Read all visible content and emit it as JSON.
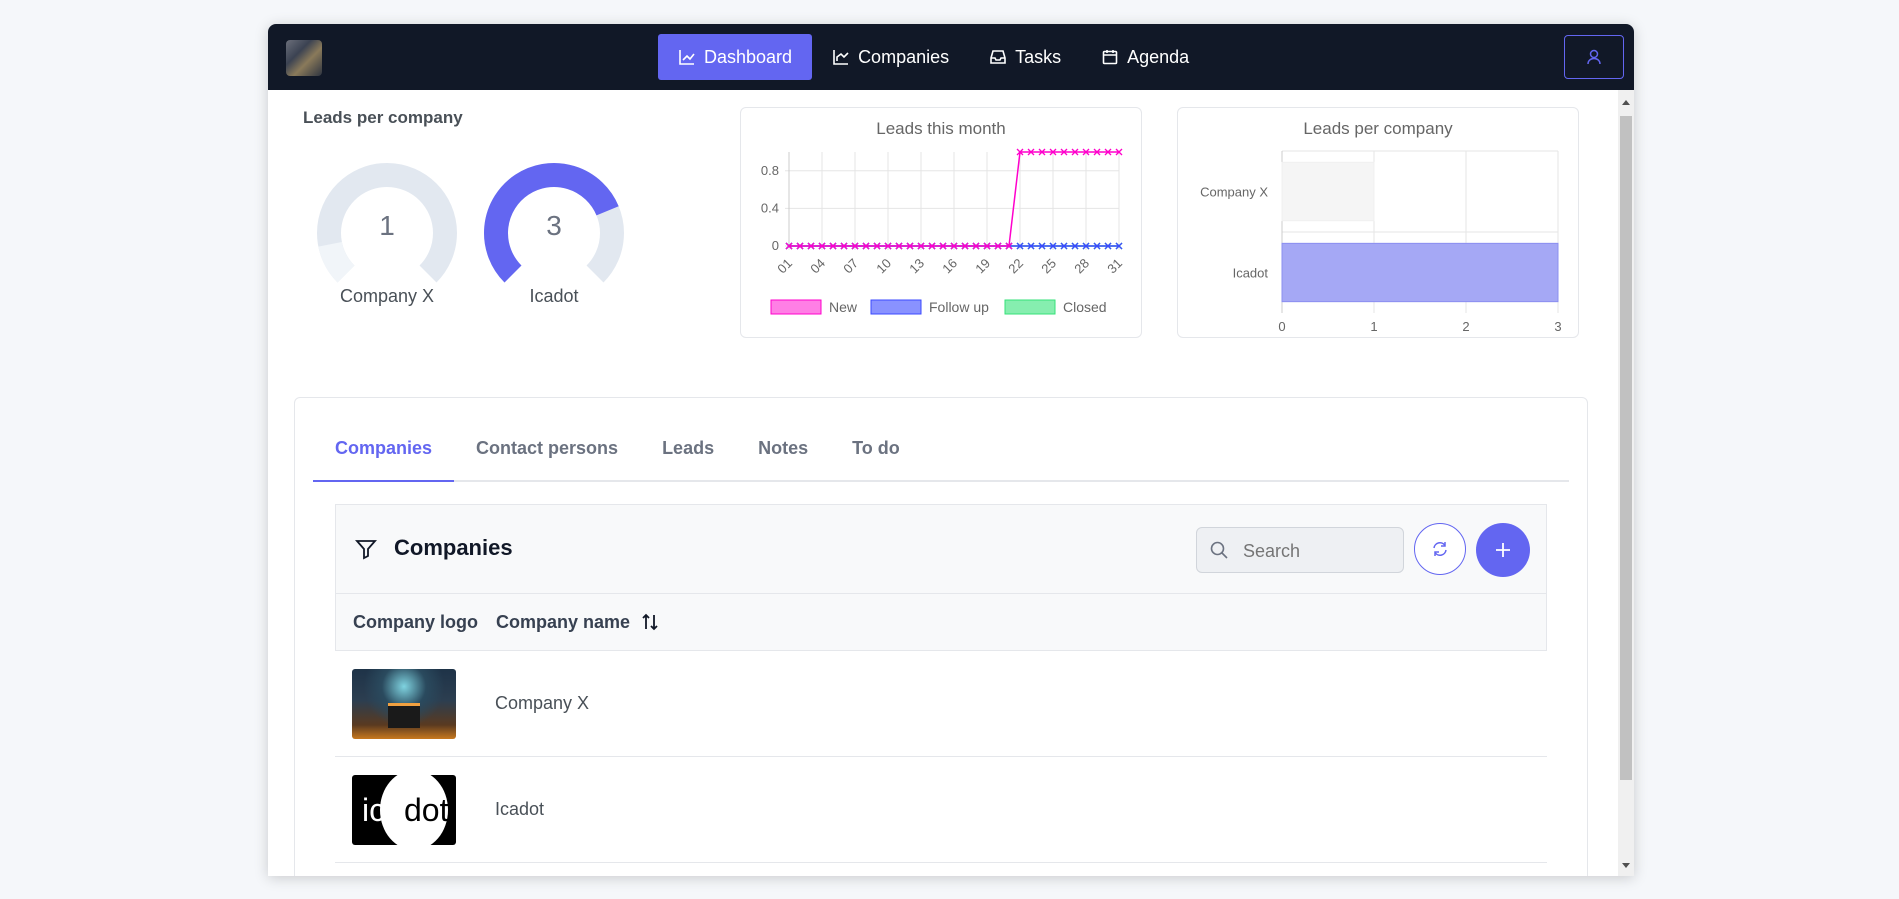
{
  "nav": {
    "items": [
      {
        "label": "Dashboard",
        "icon": "chart-line-icon",
        "active": true
      },
      {
        "label": "Companies",
        "icon": "chart-bar-icon",
        "active": false
      },
      {
        "label": "Tasks",
        "icon": "inbox-icon",
        "active": false
      },
      {
        "label": "Agenda",
        "icon": "calendar-icon",
        "active": false
      }
    ],
    "user_icon": "user-icon"
  },
  "kpi": {
    "title": "Leads per company",
    "gauges": [
      {
        "label": "Company X",
        "value": "1",
        "fraction": 0.25
      },
      {
        "label": "Icadot",
        "value": "3",
        "fraction": 0.75
      }
    ]
  },
  "chart_data": [
    {
      "type": "line",
      "title": "Leads this month",
      "x": [
        "01",
        "02",
        "03",
        "04",
        "05",
        "06",
        "07",
        "08",
        "09",
        "10",
        "11",
        "12",
        "13",
        "14",
        "15",
        "16",
        "17",
        "18",
        "19",
        "20",
        "21",
        "22",
        "23",
        "24",
        "25",
        "26",
        "27",
        "28",
        "29",
        "30",
        "31"
      ],
      "x_tick_labels": [
        "01",
        "04",
        "07",
        "10",
        "13",
        "16",
        "19",
        "22",
        "25",
        "28",
        "31"
      ],
      "y_ticks": [
        "0",
        "0.4",
        "0.8"
      ],
      "ylim": [
        0,
        1
      ],
      "series": [
        {
          "name": "New",
          "color": "#ff00cc",
          "values": [
            0,
            0,
            0,
            0,
            0,
            0,
            0,
            0,
            0,
            0,
            0,
            0,
            0,
            0,
            0,
            0,
            0,
            0,
            0,
            0,
            0,
            1,
            1,
            1,
            1,
            1,
            1,
            1,
            1,
            1,
            1
          ]
        },
        {
          "name": "Follow up",
          "color": "#3b49ff",
          "values": [
            0,
            0,
            0,
            0,
            0,
            0,
            0,
            0,
            0,
            0,
            0,
            0,
            0,
            0,
            0,
            0,
            0,
            0,
            0,
            0,
            0,
            0,
            0,
            0,
            0,
            0,
            0,
            0,
            0,
            0,
            0
          ]
        },
        {
          "name": "Closed",
          "color": "#36e27a",
          "values": [
            0,
            0,
            0,
            0,
            0,
            0,
            0,
            0,
            0,
            0,
            0,
            0,
            0,
            0,
            0,
            0,
            0,
            0,
            0,
            0,
            0,
            0,
            0,
            0,
            0,
            0,
            0,
            0,
            0,
            0,
            0
          ]
        }
      ],
      "legend": "bottom",
      "grid": true
    },
    {
      "type": "bar",
      "orientation": "horizontal",
      "title": "Leads per company",
      "categories": [
        "Company X",
        "Icadot"
      ],
      "values": [
        1,
        3
      ],
      "colors": [
        "#f5f5f5",
        "#a5a8f5"
      ],
      "xlim": [
        0,
        3
      ],
      "x_ticks": [
        "0",
        "1",
        "2",
        "3"
      ],
      "grid": true
    }
  ],
  "tabs": [
    {
      "label": "Companies",
      "active": true
    },
    {
      "label": "Contact persons",
      "active": false
    },
    {
      "label": "Leads",
      "active": false
    },
    {
      "label": "Notes",
      "active": false
    },
    {
      "label": "To do",
      "active": false
    }
  ],
  "list": {
    "title": "Companies",
    "search_placeholder": "Search",
    "columns": [
      "Company logo",
      "Company name"
    ],
    "rows": [
      {
        "name": "Company X",
        "logo": "company-x-logo"
      },
      {
        "name": "Icadot",
        "logo": "icadot-logo",
        "logo_text": "ica dot"
      }
    ]
  }
}
